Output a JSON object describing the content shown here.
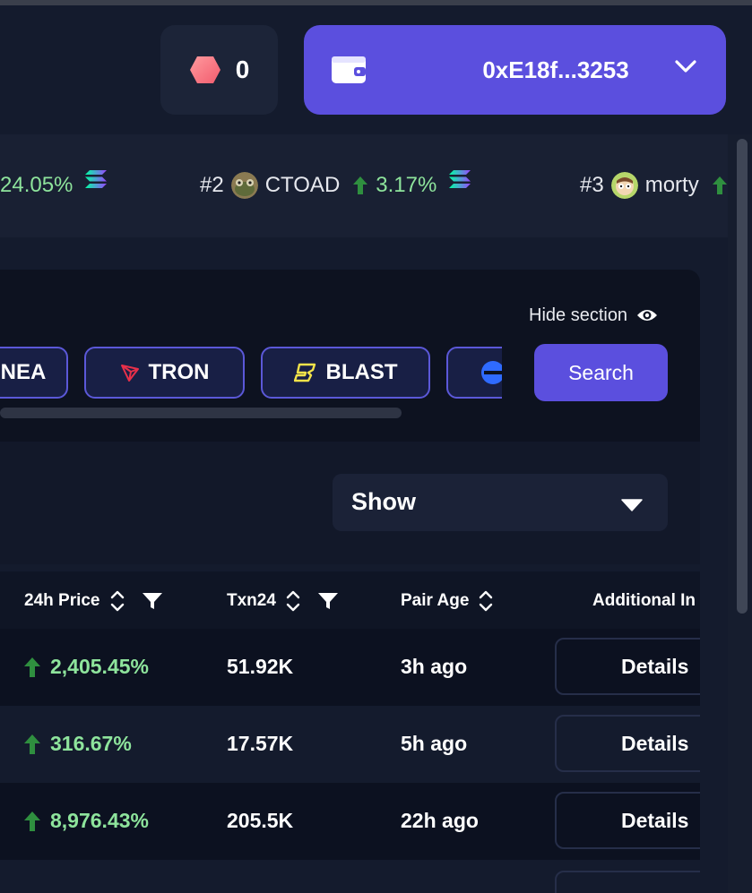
{
  "header": {
    "points_value": "0",
    "wallet_address": "0xE18f...3253"
  },
  "ticker": {
    "items": [
      {
        "rank": "",
        "symbol": "",
        "change": "24.05%"
      },
      {
        "rank": "#2",
        "symbol": "CTOAD",
        "change": "3.17%"
      },
      {
        "rank": "#3",
        "symbol": "morty",
        "change": ""
      }
    ]
  },
  "chains": {
    "hide_section_label": "Hide section",
    "search_label": "Search",
    "chips": [
      {
        "label": "NEA",
        "icon": "linea-icon"
      },
      {
        "label": "TRON",
        "icon": "tron-icon"
      },
      {
        "label": "BLAST",
        "icon": "blast-icon"
      },
      {
        "label": "",
        "icon": "blue-chain-icon"
      }
    ]
  },
  "filter": {
    "show_label": "Show"
  },
  "table": {
    "headers": {
      "price": "24h Price",
      "txn": "Txn24",
      "age": "Pair Age",
      "info": "Additional In"
    },
    "rows": [
      {
        "price": "2,405.45%",
        "txn": "51.92K",
        "age": "3h ago",
        "action": "Details"
      },
      {
        "price": "316.67%",
        "txn": "17.57K",
        "age": "5h ago",
        "action": "Details"
      },
      {
        "price": "8,976.43%",
        "txn": "205.5K",
        "age": "22h ago",
        "action": "Details"
      }
    ]
  },
  "colors": {
    "accent": "#5b4fde",
    "positive": "#8ee49c",
    "arrow": "#2f8f3f",
    "background": "#141b2d"
  }
}
